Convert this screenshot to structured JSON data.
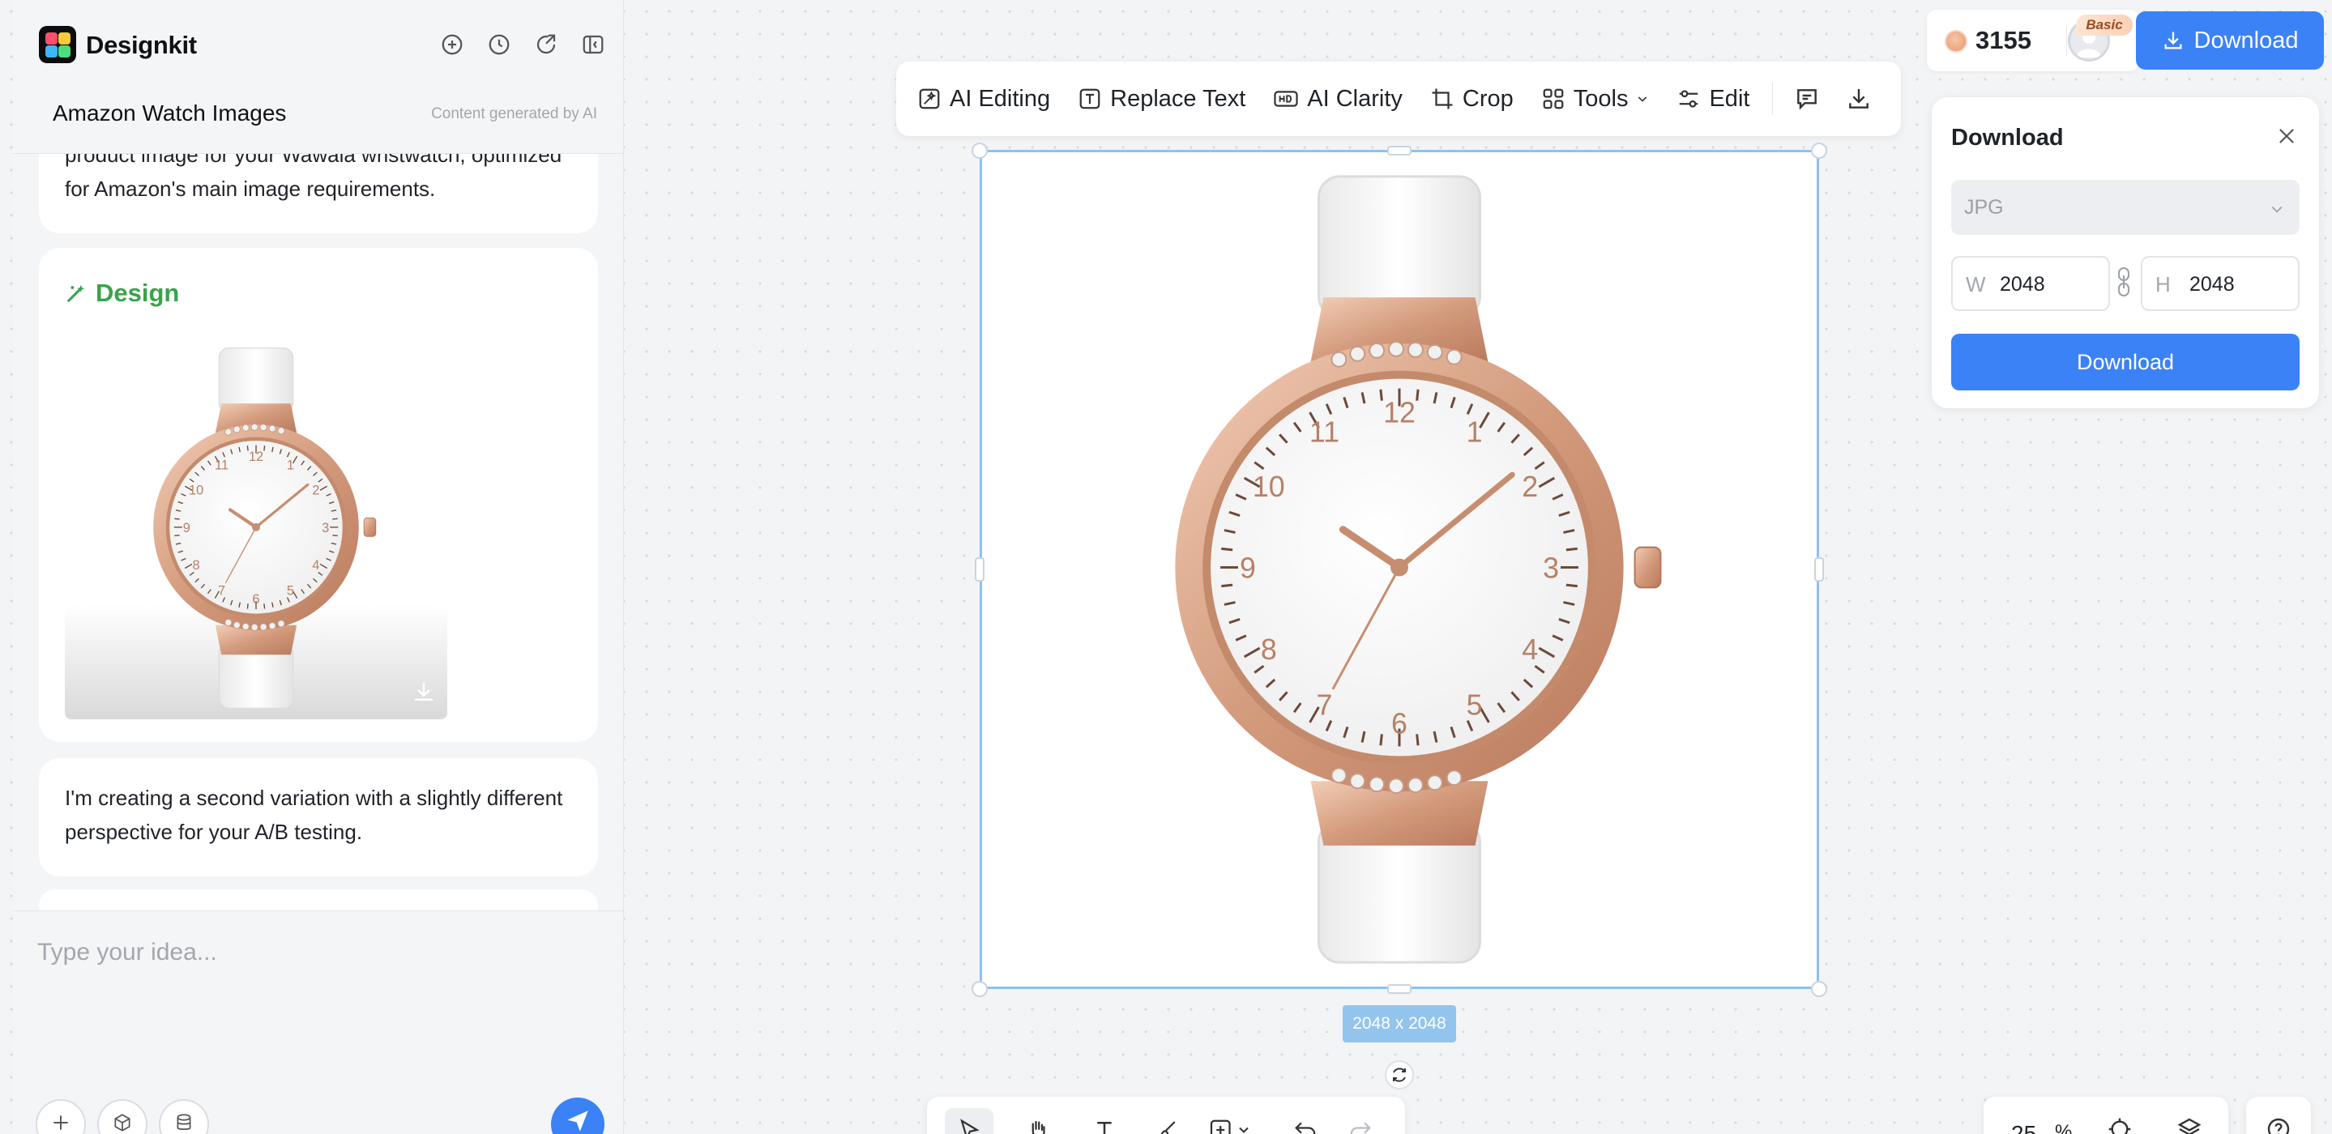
{
  "app": {
    "name": "Designkit"
  },
  "project": {
    "title": "Amazon Watch Images",
    "note": "Content generated by AI"
  },
  "chat": {
    "top_text": "product image for your Wawala wristwatch, optimized for Amazon's main image requirements.",
    "design_label": "Design",
    "variation_text": "I'm creating a second variation with a slightly different perspective for your A/B testing.",
    "input_placeholder": "Type your idea..."
  },
  "toolbar": {
    "items": [
      "AI Editing",
      "Replace Text",
      "AI Clarity",
      "Crop",
      "Tools",
      "Edit"
    ]
  },
  "canvas": {
    "size_label": "2048 x 2048"
  },
  "account": {
    "credits": "3155",
    "plan_badge": "Basic",
    "download_label": "Download"
  },
  "download_panel": {
    "title": "Download",
    "format": "JPG",
    "width_label": "W",
    "width": "2048",
    "height_label": "H",
    "height": "2048",
    "button": "Download"
  },
  "zoom": {
    "value": "25",
    "unit": "%"
  },
  "colors": {
    "accent": "#3b82f6",
    "design_green": "#39a34a",
    "selection": "#8fc2ef",
    "rose_gold": "#d8a68d"
  }
}
